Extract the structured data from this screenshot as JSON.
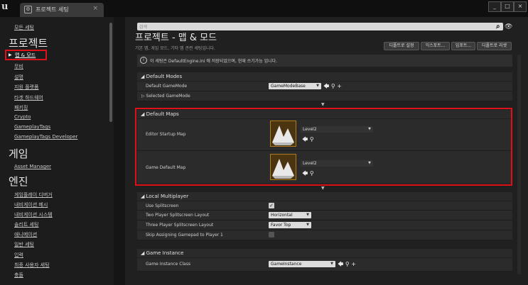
{
  "titlebar": {
    "tab_label": "프로젝트 세팅",
    "tab_close": "×"
  },
  "window_buttons": [
    "_",
    "□",
    "×"
  ],
  "sidebar": {
    "items_top": [
      {
        "label": "모든 세팅"
      }
    ],
    "category_project": "프로젝트",
    "selected": "맵 & 모드",
    "project_items": [
      {
        "label": "무비"
      },
      {
        "label": "설명"
      },
      {
        "label": "지원 플랫폼"
      },
      {
        "label": "타겟 하드웨어"
      },
      {
        "label": "패키징"
      },
      {
        "label": "Crypto"
      },
      {
        "label": "GameplayTags"
      },
      {
        "label": "GameplayTags Developer"
      }
    ],
    "category_game": "게임",
    "game_items": [
      {
        "label": "Asset Manager"
      }
    ],
    "category_engine": "엔진",
    "engine_items": [
      {
        "label": "게임플레이 디버거"
      },
      {
        "label": "내비게이션 메시"
      },
      {
        "label": "내비게이션 시스템"
      },
      {
        "label": "솔리트 세팅"
      },
      {
        "label": "애니메이션"
      },
      {
        "label": "일반 세팅"
      },
      {
        "label": "입력"
      },
      {
        "label": "최종 사용자 세팅"
      },
      {
        "label": "충돌"
      }
    ]
  },
  "search": {
    "placeholder": "검색"
  },
  "page": {
    "title": "프로젝트 - 맵 & 모드",
    "subtitle": "기본 맵, 게임 모드, 기타 맵 관련 세팅입니다.",
    "buttons": [
      "디폴트로 설정",
      "익스포트...",
      "임포트...",
      "디폴트로 리셋"
    ],
    "notice": "이 세팅은 DefaultEngine.ini 에 저장되었으며, 현재 쓰기가능 입니다."
  },
  "default_modes": {
    "header": "Default Modes",
    "game_mode_label": "Default GameMode",
    "game_mode_value": "GameModeBase",
    "selected_game_mode_label": "Selected GameMode"
  },
  "default_maps": {
    "header": "Default Maps",
    "editor_startup_label": "Editor Startup Map",
    "editor_startup_value": "Level2",
    "game_default_label": "Game Default Map",
    "game_default_value": "Level2"
  },
  "local_multiplayer": {
    "header": "Local Multiplayer",
    "use_splitscreen_label": "Use Splitscreen",
    "use_splitscreen_checked": true,
    "two_player_label": "Two Player Splitscreen Layout",
    "two_player_value": "Horizontal",
    "three_player_label": "Three Player Splitscreen Layout",
    "three_player_value": "Favor Top",
    "skip_gamepad_label": "Skip Assigning Gamepad to Player 1",
    "skip_gamepad_checked": false
  },
  "game_instance": {
    "header": "Game Instance",
    "class_label": "Game Instance Class",
    "class_value": "GameInstance"
  }
}
